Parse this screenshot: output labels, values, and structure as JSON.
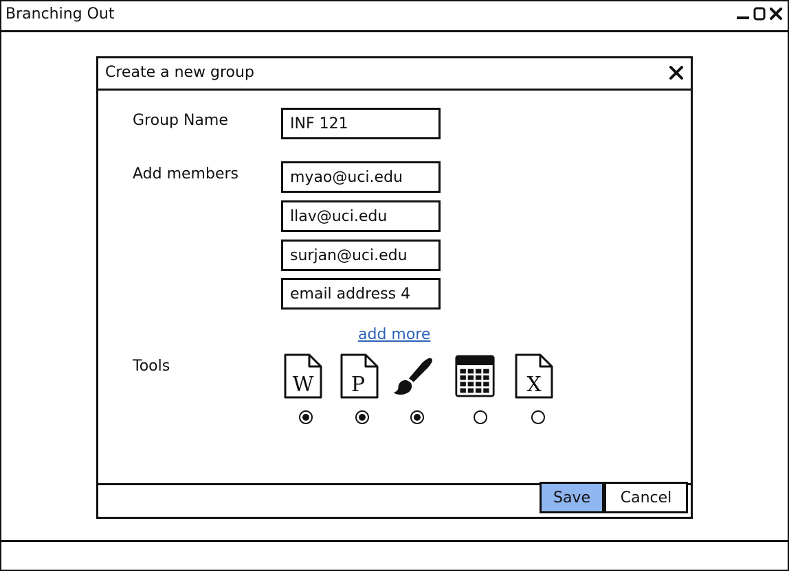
{
  "window": {
    "title": "Branching Out"
  },
  "dialog": {
    "title": "Create a new group",
    "group_name": {
      "label": "Group Name",
      "value": "INF 121"
    },
    "members": {
      "label": "Add members",
      "fields": [
        "myao@uci.edu",
        "llav@uci.edu",
        "surjan@uci.edu",
        "email address 4"
      ],
      "add_more": "add more"
    },
    "tools": {
      "label": "Tools",
      "items": [
        {
          "icon": "word-document-icon",
          "letter": "W",
          "selected": true
        },
        {
          "icon": "powerpoint-document-icon",
          "letter": "P",
          "selected": true
        },
        {
          "icon": "paintbrush-icon",
          "letter": "",
          "selected": true
        },
        {
          "icon": "calculator-icon",
          "letter": "",
          "selected": false
        },
        {
          "icon": "excel-document-icon",
          "letter": "X",
          "selected": false
        }
      ]
    },
    "buttons": {
      "save": "Save",
      "cancel": "Cancel"
    }
  },
  "colors": {
    "save_button": "#8fb6ef",
    "link": "#2d64b8"
  }
}
